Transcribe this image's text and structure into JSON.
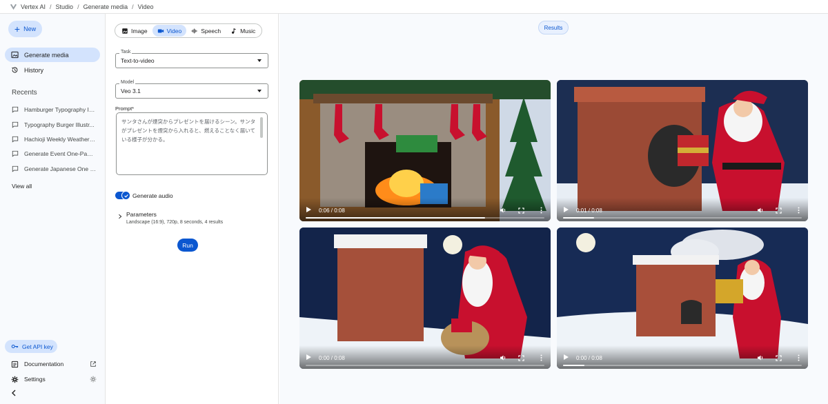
{
  "breadcrumb": [
    "Vertex AI",
    "Studio",
    "Generate media",
    "Video"
  ],
  "sidebar": {
    "new_label": "New",
    "nav": [
      {
        "label": "Generate media",
        "icon": "image-edit-icon",
        "active": true
      },
      {
        "label": "History",
        "icon": "history-icon",
        "active": false
      }
    ],
    "recents_title": "Recents",
    "recents": [
      "Hamburger Typography Ill...",
      "Typography Burger Illustr...",
      "Hachioji Weekly Weather ...",
      "Generate Event One-Page...",
      "Generate Japanese One P..."
    ],
    "view_all": "View all",
    "api_key_label": "Get API key",
    "documentation_label": "Documentation",
    "settings_label": "Settings"
  },
  "mode_tabs": [
    {
      "label": "Image",
      "icon": "image-icon",
      "active": false
    },
    {
      "label": "Video",
      "icon": "videocam-icon",
      "active": true
    },
    {
      "label": "Speech",
      "icon": "waveform-icon",
      "active": false
    },
    {
      "label": "Music",
      "icon": "music-note-icon",
      "active": false
    }
  ],
  "task": {
    "label": "Task",
    "value": "Text-to-video"
  },
  "model": {
    "label": "Model",
    "value": "Veo 3.1"
  },
  "prompt": {
    "label": "Prompt*",
    "value": "サンタさんが煙突からプレゼントを届けるシーン。サンタがプレゼントを煙突から入れると、燃えることなく届いている様子が分かる。"
  },
  "generate_audio": {
    "label": "Generate audio",
    "enabled": true
  },
  "parameters": {
    "title": "Parameters",
    "summary": "Landscape (16:9), 720p, 8 seconds, 4 results"
  },
  "run_label": "Run",
  "results_label": "Results",
  "videos": [
    {
      "time": "0:06 / 0:08",
      "progress": 0.75
    },
    {
      "time": "0:01 / 0:08",
      "progress": 0.13
    },
    {
      "time": "0:00 / 0:08",
      "progress": 0.0
    },
    {
      "time": "0:00 / 0:08",
      "progress": 0.09
    }
  ],
  "colors": {
    "accent": "#0b57d0",
    "chip_bg": "#d3e3fd"
  }
}
